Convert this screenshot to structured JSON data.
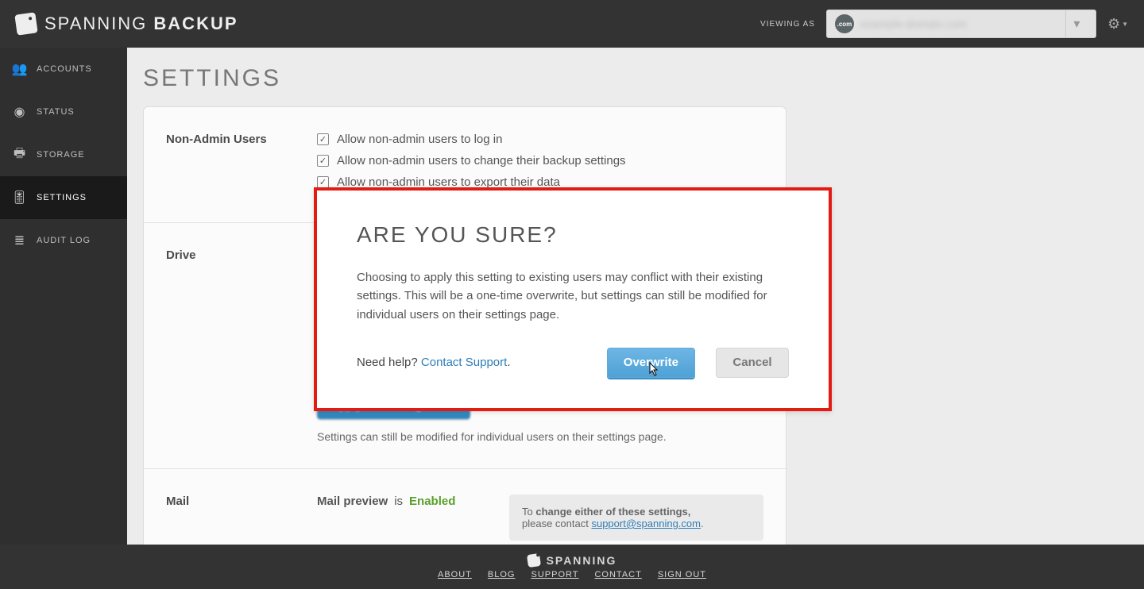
{
  "header": {
    "brand_a": "SPANNING",
    "brand_b": "BACKUP",
    "viewing_as": "VIEWING AS",
    "domain_badge": ".com",
    "domain_text": "example-domain.com"
  },
  "sidebar": {
    "items": [
      {
        "label": "ACCOUNTS",
        "icon": "👥",
        "name": "sidebar-item-accounts"
      },
      {
        "label": "STATUS",
        "icon": "◉",
        "name": "sidebar-item-status"
      },
      {
        "label": "STORAGE",
        "icon": "🖨",
        "name": "sidebar-item-storage"
      },
      {
        "label": "SETTINGS",
        "icon": "🎛",
        "name": "sidebar-item-settings"
      },
      {
        "label": "AUDIT LOG",
        "icon": "≣",
        "name": "sidebar-item-audit-log"
      }
    ],
    "active_index": 3
  },
  "page": {
    "title": "SETTINGS",
    "sections": {
      "nonadmin": {
        "label": "Non-Admin Users",
        "checks": [
          "Allow non-admin users to log in",
          "Allow non-admin users to change their backup settings",
          "Allow non-admin users to export their data"
        ]
      },
      "drive": {
        "label": "Drive",
        "apply_btn": "Apply to Existing Users",
        "note": "Settings can still be modified for individual users on their settings page."
      },
      "mail": {
        "label": "Mail",
        "preview_label": "Mail preview",
        "is_text": "is",
        "status": "Enabled",
        "change_text_a": "To",
        "change_text_b": "change either of these settings,",
        "change_text_c": "please contact",
        "support_email": "support@spanning.com"
      }
    }
  },
  "modal": {
    "title": "ARE YOU SURE?",
    "body": "Choosing to apply this setting to existing users may conflict with their existing settings. This will be a one-time overwrite, but settings can still be modified for individual users on their settings page.",
    "help_prefix": "Need help?",
    "help_link": "Contact Support",
    "overwrite": "Overwrite",
    "cancel": "Cancel"
  },
  "footer": {
    "brand": "SPANNING",
    "links": [
      "ABOUT",
      "BLOG",
      "SUPPORT",
      "CONTACT",
      "SIGN OUT"
    ]
  }
}
